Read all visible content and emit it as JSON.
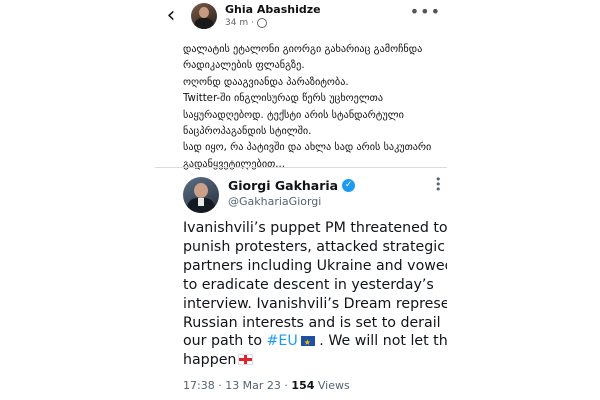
{
  "post": {
    "author": "Ghia Abashidze",
    "time": "34 m",
    "lines": [
      "დალატის ეტალონი გიორგი გახარიაც გამოჩნდა",
      "რადიკალების ფლანგზე.",
      "ოღონდ დააგვიანდა პარაზიტობა.",
      "Twitter-ში ინგლისურად წერს უცხოელთა",
      "საყურადღებოდ. ტექსტი არის სტანდარტული",
      "ნაცპროპაგანდის სტილში.",
      "სად იყო, რა პატივში და ახლა სად არის საკუთარი",
      "გადანყვეტილებით..."
    ]
  },
  "tweet": {
    "name": "Giorgi Gakharia",
    "handle": "@GakhariaGiorgi",
    "verified": true,
    "lines": [
      "Ivanishvili’s puppet PM threatened to",
      "punish protesters, attacked strategic",
      "partners including Ukraine and vowed",
      "to eradicate descent in yesterday’s",
      "interview. Ivanishvili’s Dream represents",
      "Russian interests and is set to derail"
    ],
    "line7_before": "our path to ",
    "hashtag": "#EU",
    "line7_after": " . We will not let this",
    "line8": "happen",
    "time": "17:38 · 13 Mar 23 · ",
    "views_count": "154",
    "views_label": " Views"
  },
  "colors": {
    "accent": "#1d9bf0",
    "meta_grey": "#65676b"
  },
  "icons": {
    "back": "chevron-left-icon",
    "globe": "globe-icon",
    "more": "more-horizontal-icon",
    "verified": "verified-badge-icon",
    "eu_flag": "eu-flag-icon",
    "ge_flag": "georgia-flag-icon"
  }
}
